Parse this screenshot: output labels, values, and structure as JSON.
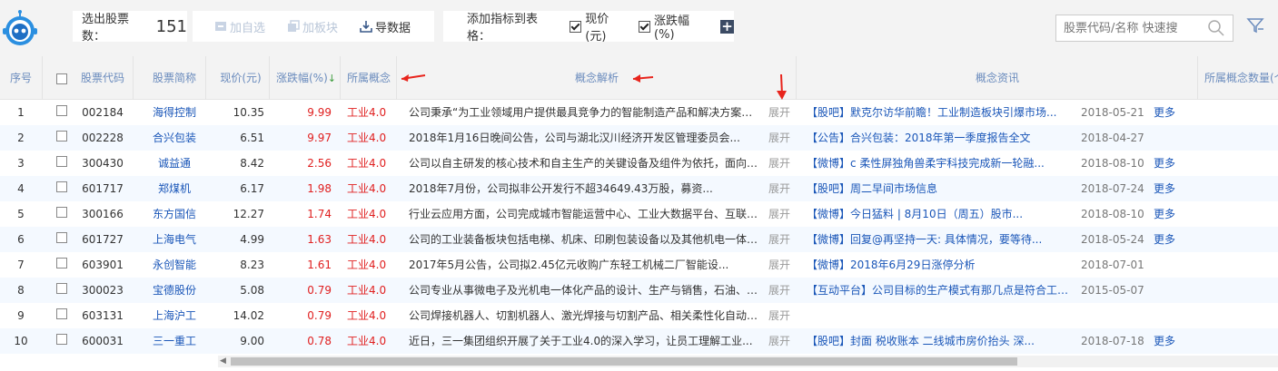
{
  "toolbar": {
    "selected_label": "选出股票数：",
    "selected_count": "151",
    "add_watchlist": "加自选",
    "add_block": "加板块",
    "export": "导数据",
    "add_indicator_label": "添加指标到表格：",
    "indicators": [
      {
        "label": "现价(元)",
        "checked": true
      },
      {
        "label": "涨跌幅(%)",
        "checked": true
      }
    ],
    "add_icon": "plus-icon"
  },
  "search": {
    "placeholder": "股票代码/名称 快速搜",
    "icon": "search-icon"
  },
  "filter_icon": "filter-icon",
  "colors": {
    "header_text": "#6a8bbd",
    "link": "#1a56b8",
    "rise": "#e02020",
    "arrow": "#e8241c",
    "alt_row": "#f4f9ff"
  },
  "columns": {
    "index": "序号",
    "code": "股票代码",
    "name": "股票简称",
    "price": "现价(元)",
    "change": "涨跌幅(%)",
    "change_sort": "↓",
    "concept": "所属概念",
    "analysis": "概念解析",
    "news": "概念资讯",
    "concept_count": "所属概念数量(个"
  },
  "rows": [
    {
      "idx": "1",
      "code": "002184",
      "name": "海得控制",
      "price": "10.35",
      "change": "9.99",
      "concept": "工业4.0",
      "analysis": "公司秉承“为工业领域用户提供最具竞争力的智能制造产品和解决方案，...",
      "expand": "展开",
      "news": "【股吧】默克尔访华前瞻！工业制造板块引爆市场...",
      "date": "2018-05-21",
      "more": "更多"
    },
    {
      "idx": "2",
      "code": "002228",
      "name": "合兴包装",
      "price": "6.51",
      "change": "9.97",
      "concept": "工业4.0",
      "analysis": "2018年1月16日晚间公告，公司与湖北汉川经济开发区管理委员会...",
      "expand": "展开",
      "news": "【公告】合兴包装：2018年第一季度报告全文",
      "date": "2018-04-27",
      "more": ""
    },
    {
      "idx": "3",
      "code": "300430",
      "name": "诚益通",
      "price": "8.42",
      "change": "2.56",
      "concept": "工业4.0",
      "analysis": "公司以自主研发的核心技术和自主生产的关键设备及组件为依托，面向大...",
      "expand": "展开",
      "news": "【微博】c 柔性屏独角兽柔宇科技完成新一轮融...",
      "date": "2018-08-10",
      "more": "更多"
    },
    {
      "idx": "4",
      "code": "601717",
      "name": "郑煤机",
      "price": "6.17",
      "change": "1.98",
      "concept": "工业4.0",
      "analysis": "2018年7月份，公司拟非公开发行不超34649.43万股，募资...",
      "expand": "展开",
      "news": "【股吧】周二早间市场信息",
      "date": "2018-07-24",
      "more": "更多"
    },
    {
      "idx": "5",
      "code": "300166",
      "name": "东方国信",
      "price": "12.27",
      "change": "1.74",
      "concept": "工业4.0",
      "analysis": "行业云应用方面，公司完成城市智能运营中心、工业大数据平台、互联网...",
      "expand": "展开",
      "news": "【微博】今日猛料 | 8月10日（周五）股市...",
      "date": "2018-08-10",
      "more": "更多"
    },
    {
      "idx": "6",
      "code": "601727",
      "name": "上海电气",
      "price": "4.99",
      "change": "1.63",
      "concept": "工业4.0",
      "analysis": "公司的工业装备板块包括电梯、机床、印刷包装设备以及其他机电一体化...",
      "expand": "展开",
      "news": "【微博】回复@再坚持一天: 具体情况，要等待...",
      "date": "2018-05-24",
      "more": "更多"
    },
    {
      "idx": "7",
      "code": "603901",
      "name": "永创智能",
      "price": "8.23",
      "change": "1.61",
      "concept": "工业4.0",
      "analysis": "2017年5月公告，公司拟2.45亿元收购广东轻工机械二厂智能设...",
      "expand": "展开",
      "news": "【微博】2018年6月29日涨停分析",
      "date": "2018-07-01",
      "more": ""
    },
    {
      "idx": "8",
      "code": "300023",
      "name": "宝德股份",
      "price": "5.08",
      "change": "0.79",
      "concept": "工业4.0",
      "analysis": "公司专业从事微电子及光机电一体化产品的设计、生产与销售，石油、煤...",
      "expand": "展开",
      "news": "【互动平台】公司目标的生产模式有那几点是符合工业...",
      "date": "2015-05-07",
      "more": ""
    },
    {
      "idx": "9",
      "code": "603131",
      "name": "上海沪工",
      "price": "14.02",
      "change": "0.79",
      "concept": "工业4.0",
      "analysis": "公司焊接机器人、切割机器人、激光焊接与切割产品、相关柔性化自动生...",
      "expand": "展开",
      "news": "",
      "date": "",
      "more": ""
    },
    {
      "idx": "10",
      "code": "600031",
      "name": "三一重工",
      "price": "9.00",
      "change": "0.78",
      "concept": "工业4.0",
      "analysis": "近日，三一集团组织开展了关于工业4.0的深入学习，让员工理解工业...",
      "expand": "展开",
      "news": "【股吧】封面 税收账本 二线城市房价抬头 深...",
      "date": "2018-07-18",
      "more": "更多"
    }
  ]
}
